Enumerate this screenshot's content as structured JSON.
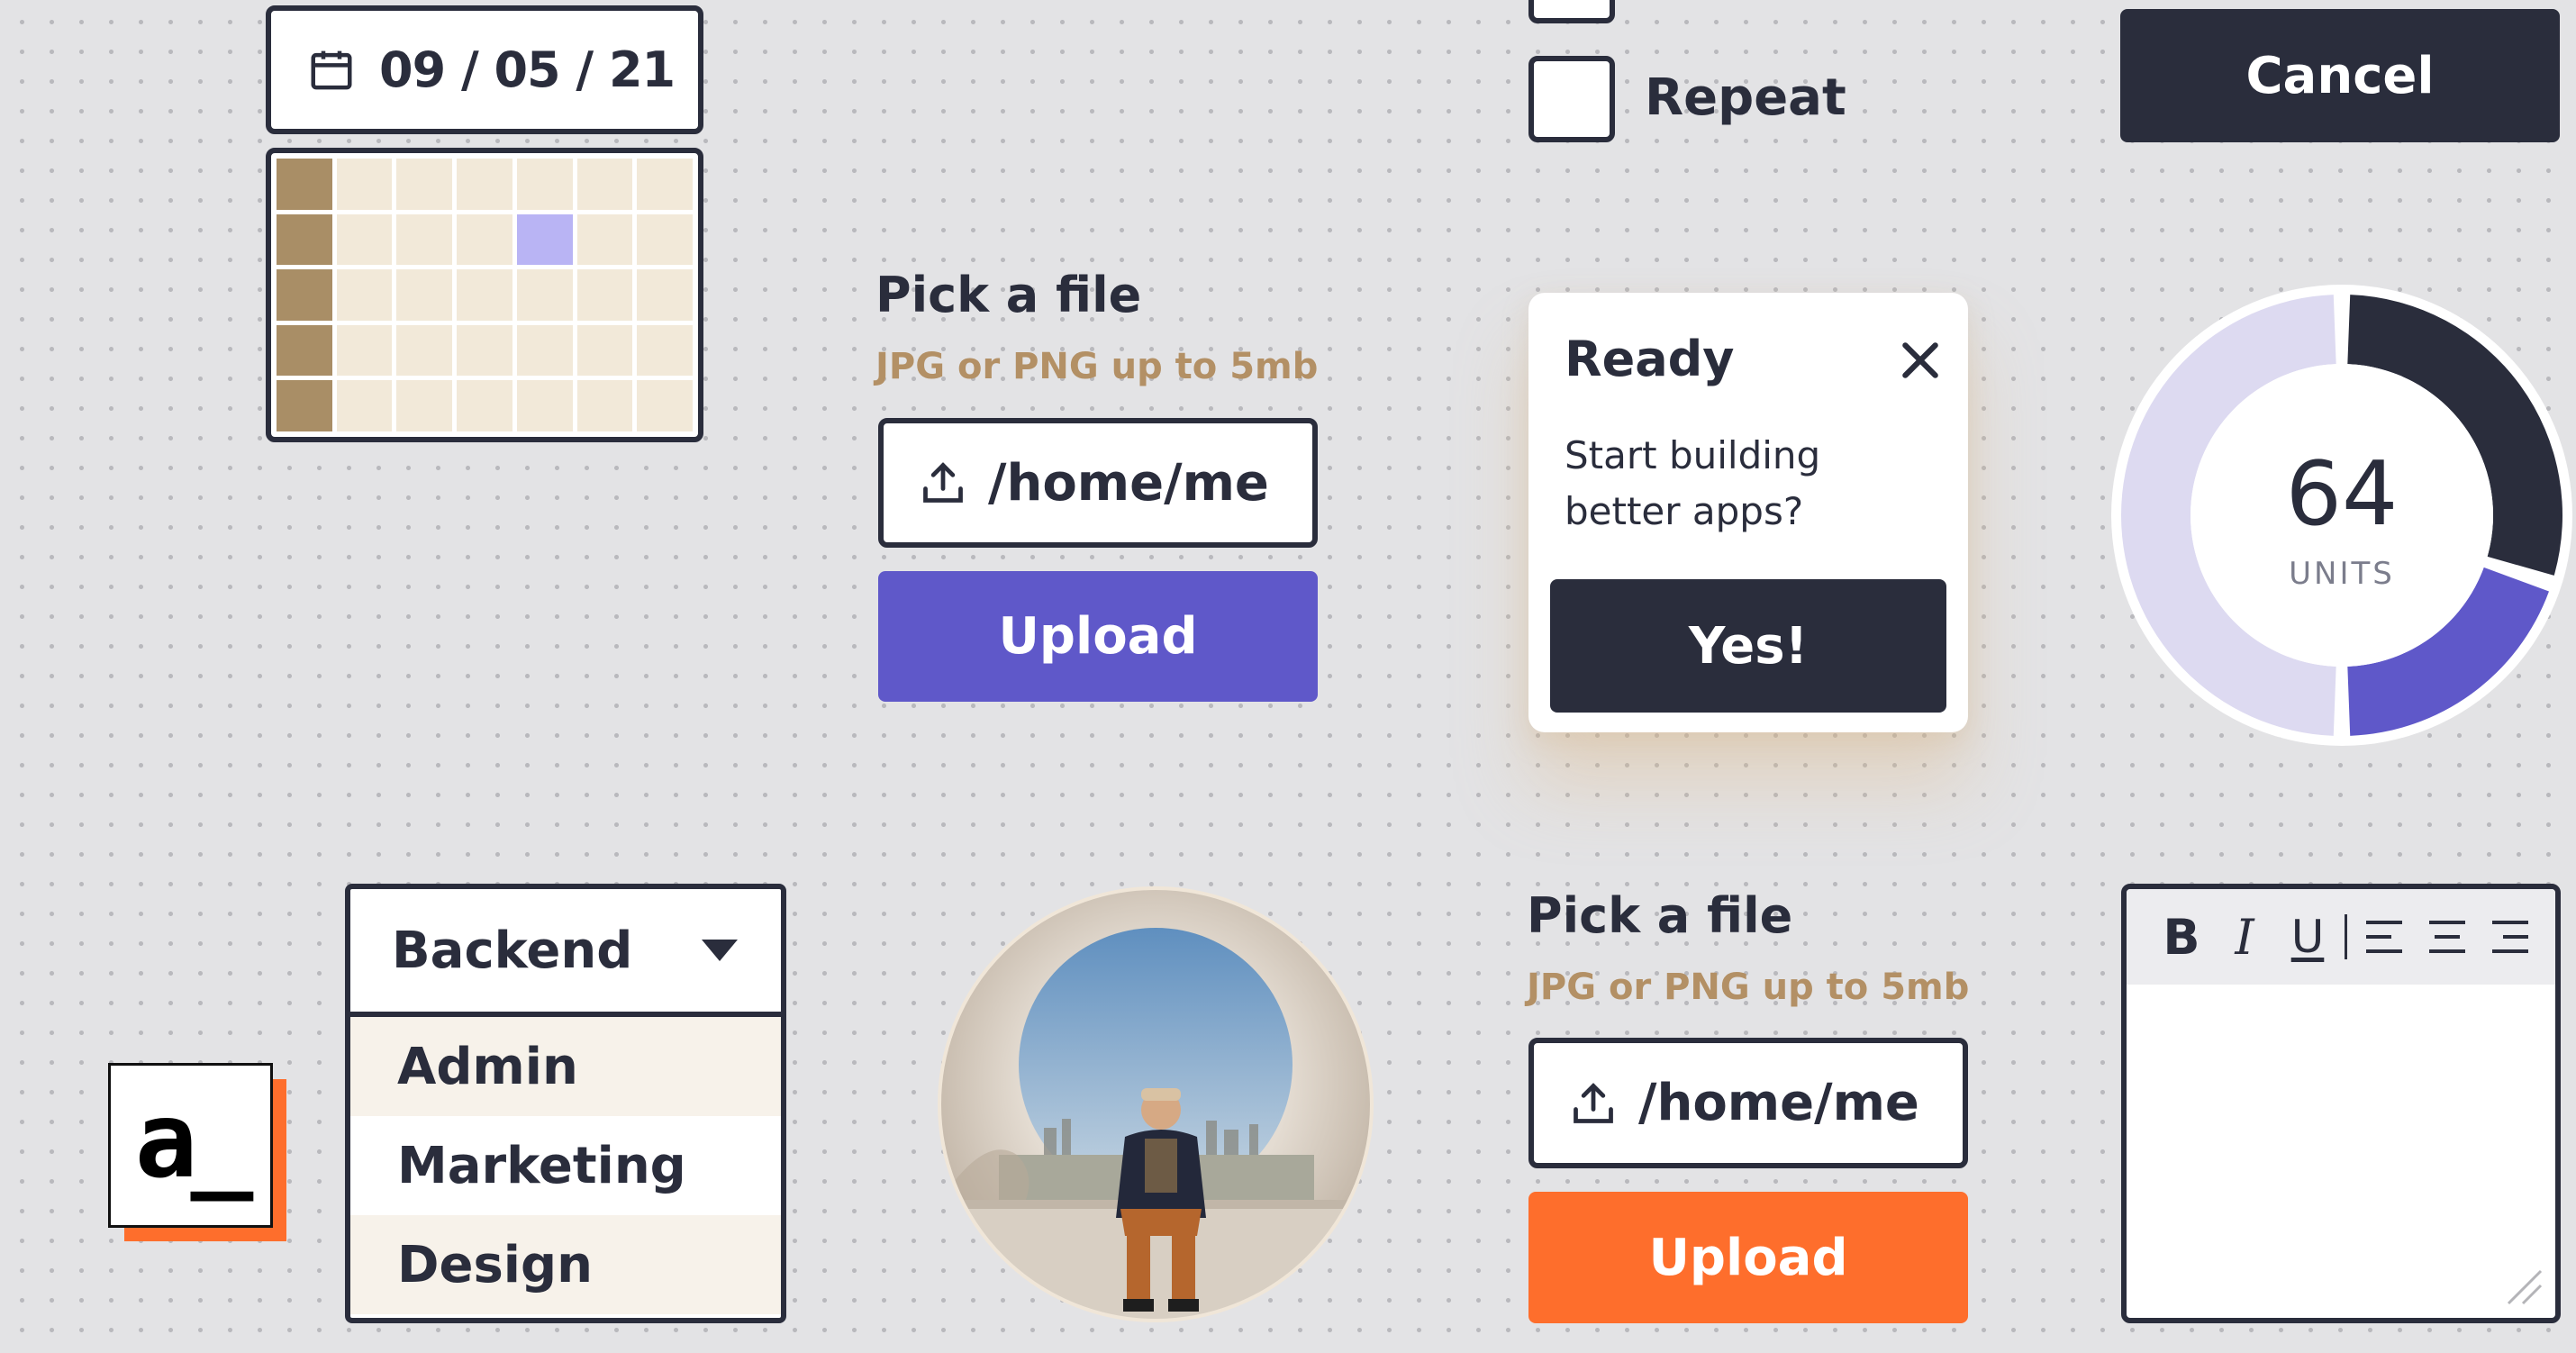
{
  "date_picker": {
    "value": "09 / 05 / 21",
    "icon": "calendar-icon"
  },
  "calendar_grid": {
    "rows": 5,
    "cols": 7,
    "selected_row": 1,
    "selected_col": 4
  },
  "checkboxes": [
    {
      "label": "",
      "checked": false
    },
    {
      "label": "Repeat",
      "checked": false
    }
  ],
  "cancel_button": {
    "label": "Cancel"
  },
  "file_picker_1": {
    "title": "Pick a file",
    "subtitle": "JPG or PNG up to 5mb",
    "path": "/home/me",
    "upload_label": "Upload",
    "accent": "#5f58c9"
  },
  "file_picker_2": {
    "title": "Pick a file",
    "subtitle": "JPG or PNG up to 5mb",
    "path": "/home/me",
    "upload_label": "Upload",
    "accent": "#fe6e2c"
  },
  "toast": {
    "title": "Ready",
    "body": "Start building better apps?",
    "confirm_label": "Yes!"
  },
  "donut": {
    "value": "64",
    "unit": "UNITS",
    "segments": [
      {
        "fraction": 0.3,
        "color": "#2a2d3c"
      },
      {
        "fraction": 0.2,
        "color": "#5f58c9"
      },
      {
        "fraction": 0.5,
        "color": "#dddaf1"
      }
    ]
  },
  "dropdown": {
    "selected": "Backend",
    "options": [
      "Admin",
      "Marketing",
      "Design"
    ]
  },
  "logo": {
    "text": "a_"
  },
  "editor": {
    "toolbar": [
      "bold-icon",
      "italic-icon",
      "underline-icon",
      "align-left-icon",
      "align-center-icon",
      "align-right-icon"
    ]
  },
  "colors": {
    "ink": "#2a2d3c",
    "purple": "#5f58c9",
    "orange": "#fe6e2c",
    "tan": "#b39065"
  }
}
